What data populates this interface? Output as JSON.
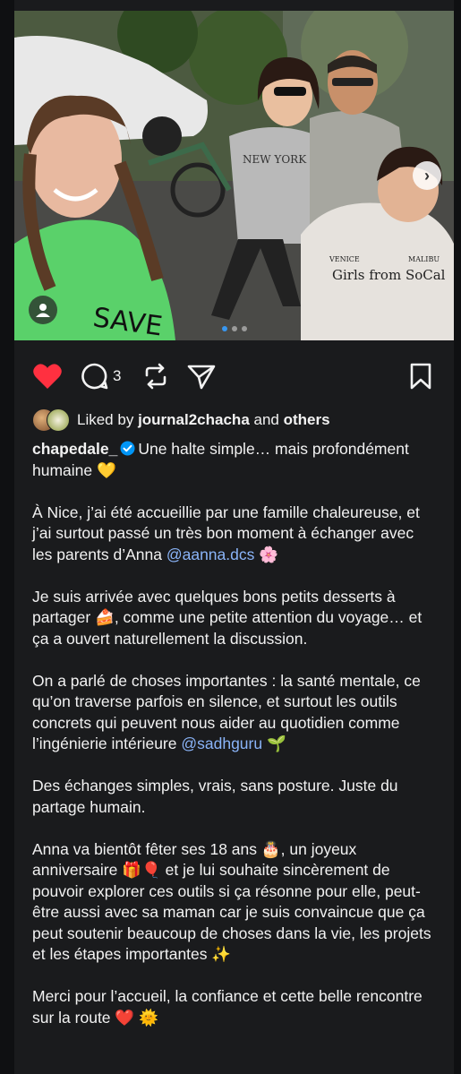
{
  "post": {
    "slide_count": 3,
    "active_slide": 1,
    "photo_description": "Selfie of four people outdoors",
    "shirt_text_1": "NEW YORK",
    "shirt_text_2": "Girls from SoCal",
    "shirt_text_3": "VENICE",
    "shirt_text_4": "MALIBU"
  },
  "actions": {
    "comment_count": "3"
  },
  "likes": {
    "prefix": "Liked by",
    "user": "journal2chacha",
    "middle": "and",
    "others": "others"
  },
  "caption": {
    "username": "chapedale_",
    "line1_rest": "Une halte simple… mais profondément humaine 💛",
    "p2_text": "À Nice, j’ai été accueillie par une famille chaleureuse, et j’ai surtout passé un très bon moment à échanger avec les parents d’Anna",
    "p2_mention": "@aanna.dcs",
    "p2_end": "🌸",
    "p3": "Je suis arrivée avec quelques bons petits desserts à partager 🍰, comme une petite attention du voyage… et ça a ouvert naturellement la discussion.",
    "p4_text": "On a parlé de choses importantes : la santé mentale, ce qu’on traverse parfois en silence, et surtout les outils concrets qui peuvent nous aider au quotidien comme l’ingénierie intérieure",
    "p4_mention": "@sadhguru",
    "p4_end": "🌱",
    "p5": "Des échanges simples, vrais, sans posture. Juste du partage humain.",
    "p6": "Anna va bientôt fêter ses 18 ans 🎂, un joyeux anniversaire 🎁🎈 et je lui souhaite sincèrement de pouvoir explorer ces outils si ça résonne pour elle, peut-être aussi avec sa maman car je suis convaincue que ça peut soutenir beaucoup de choses dans la vie, les projets et les étapes importantes ✨",
    "p7": "Merci pour l’accueil, la confiance et cette belle rencontre sur la route ❤️ 🌞"
  },
  "colors": {
    "background": "#0f1012",
    "card": "#1a1b1d",
    "like_red": "#ff3040",
    "mention": "#8ab4f8",
    "verified": "#0095f6"
  },
  "icons": [
    "heart-icon",
    "comment-icon",
    "repost-icon",
    "share-icon",
    "bookmark-icon",
    "verified-icon",
    "user-tag-icon",
    "chevron-right-icon"
  ]
}
